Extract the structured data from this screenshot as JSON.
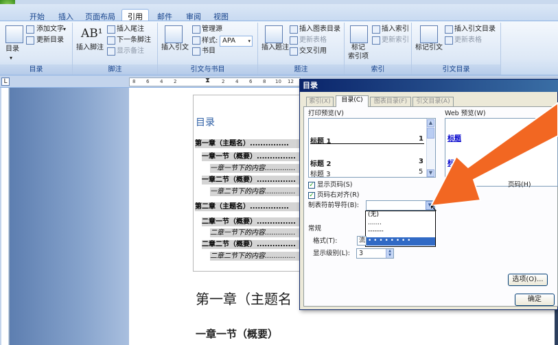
{
  "ribbon": {
    "tabs": [
      "开始",
      "插入",
      "页面布局",
      "引用",
      "邮件",
      "审阅",
      "视图"
    ],
    "active_tab": "引用",
    "groups": {
      "toc": {
        "label": "目录",
        "big_button": "目录",
        "add_text": "添加文字",
        "update_toc": "更新目录"
      },
      "footnote": {
        "label": "脚注",
        "insert_footnote": "插入脚注",
        "insert_endnote": "插入尾注",
        "next_footnote": "下一条脚注",
        "show_notes": "显示备注"
      },
      "citation": {
        "label": "引文与书目",
        "insert_citation": "插入引文",
        "manage_sources": "管理源",
        "style_label": "样式:",
        "style_value": "APA",
        "bibliography": "书目"
      },
      "caption": {
        "label": "题注",
        "insert_caption": "插入题注",
        "insert_table_of_figures": "插入图表目录",
        "update_table": "更新表格",
        "cross_reference": "交叉引用"
      },
      "index": {
        "label": "索引",
        "mark_entry": "标记\n索引项",
        "mark_entry_line1": "标记",
        "mark_entry_line2": "索引项",
        "insert_index": "插入索引",
        "update_index": "更新索引"
      },
      "toa": {
        "label": "引文目录",
        "mark_citation": "标记引文",
        "insert_toa": "插入引文目录",
        "update_table": "更新表格"
      }
    }
  },
  "ruler": {
    "ticks": [
      "8",
      "6",
      "4",
      "2",
      "2",
      "4",
      "6",
      "8",
      "10",
      "12",
      "14"
    ],
    "corner": "L"
  },
  "document": {
    "toc_title": "目录",
    "toc_entries": [
      {
        "text": "第一章（主题名）",
        "level": 1
      },
      {
        "text": "一章一节（概要）",
        "level": 2
      },
      {
        "text": "一章一节下的内容",
        "level": 3
      },
      {
        "text": "一章二节（概要）",
        "level": 2
      },
      {
        "text": "一章二节下的内容",
        "level": 3
      },
      {
        "text": "第二章（主题名）",
        "level": 1
      },
      {
        "text": "二章一节（概要）",
        "level": 2
      },
      {
        "text": "二章一节下的内容",
        "level": 3
      },
      {
        "text": "二章二节（概要）",
        "level": 2
      },
      {
        "text": "二章二节下的内容",
        "level": 3
      }
    ],
    "heading1": "第一章（主题名",
    "heading2": "一章一节（概要）"
  },
  "dialog": {
    "title": "目录",
    "tabs": [
      {
        "label": "索引(X)",
        "active": false
      },
      {
        "label": "目录(C)",
        "active": true
      },
      {
        "label": "图表目录(F)",
        "active": false
      },
      {
        "label": "引文目录(A)",
        "active": false
      }
    ],
    "print_preview_label": "打印预览(V)",
    "web_preview_label": "Web 预览(W)",
    "preview_rows": [
      {
        "text": "标题  1",
        "page": "1",
        "bold": true
      },
      {
        "text": "标题  2",
        "page": "3",
        "bold": true
      },
      {
        "text": "标题  3",
        "page": "5",
        "bold": false
      }
    ],
    "web_preview_rows": [
      "标题",
      "标"
    ],
    "show_page_numbers": {
      "label": "显示页码(S)",
      "checked": true
    },
    "right_align_page_numbers": {
      "label": "页码右对齐(R)",
      "checked": true
    },
    "web_use_hyperlinks_partial": "页码(H)",
    "tab_leader_label": "制表符前导符(B):",
    "tab_leader_options": [
      "(无)",
      ".......",
      "-------",
      "_______"
    ],
    "general_label": "常规",
    "format_label": "格式(T):",
    "format_value": "流",
    "levels_label": "显示级别(L):",
    "levels_value": "3",
    "options_button": "选项(O)...",
    "ok_button": "确定"
  },
  "colors": {
    "arrow": "#f26722",
    "accent": "#15428b",
    "toc_title": "#2e5fa5"
  }
}
